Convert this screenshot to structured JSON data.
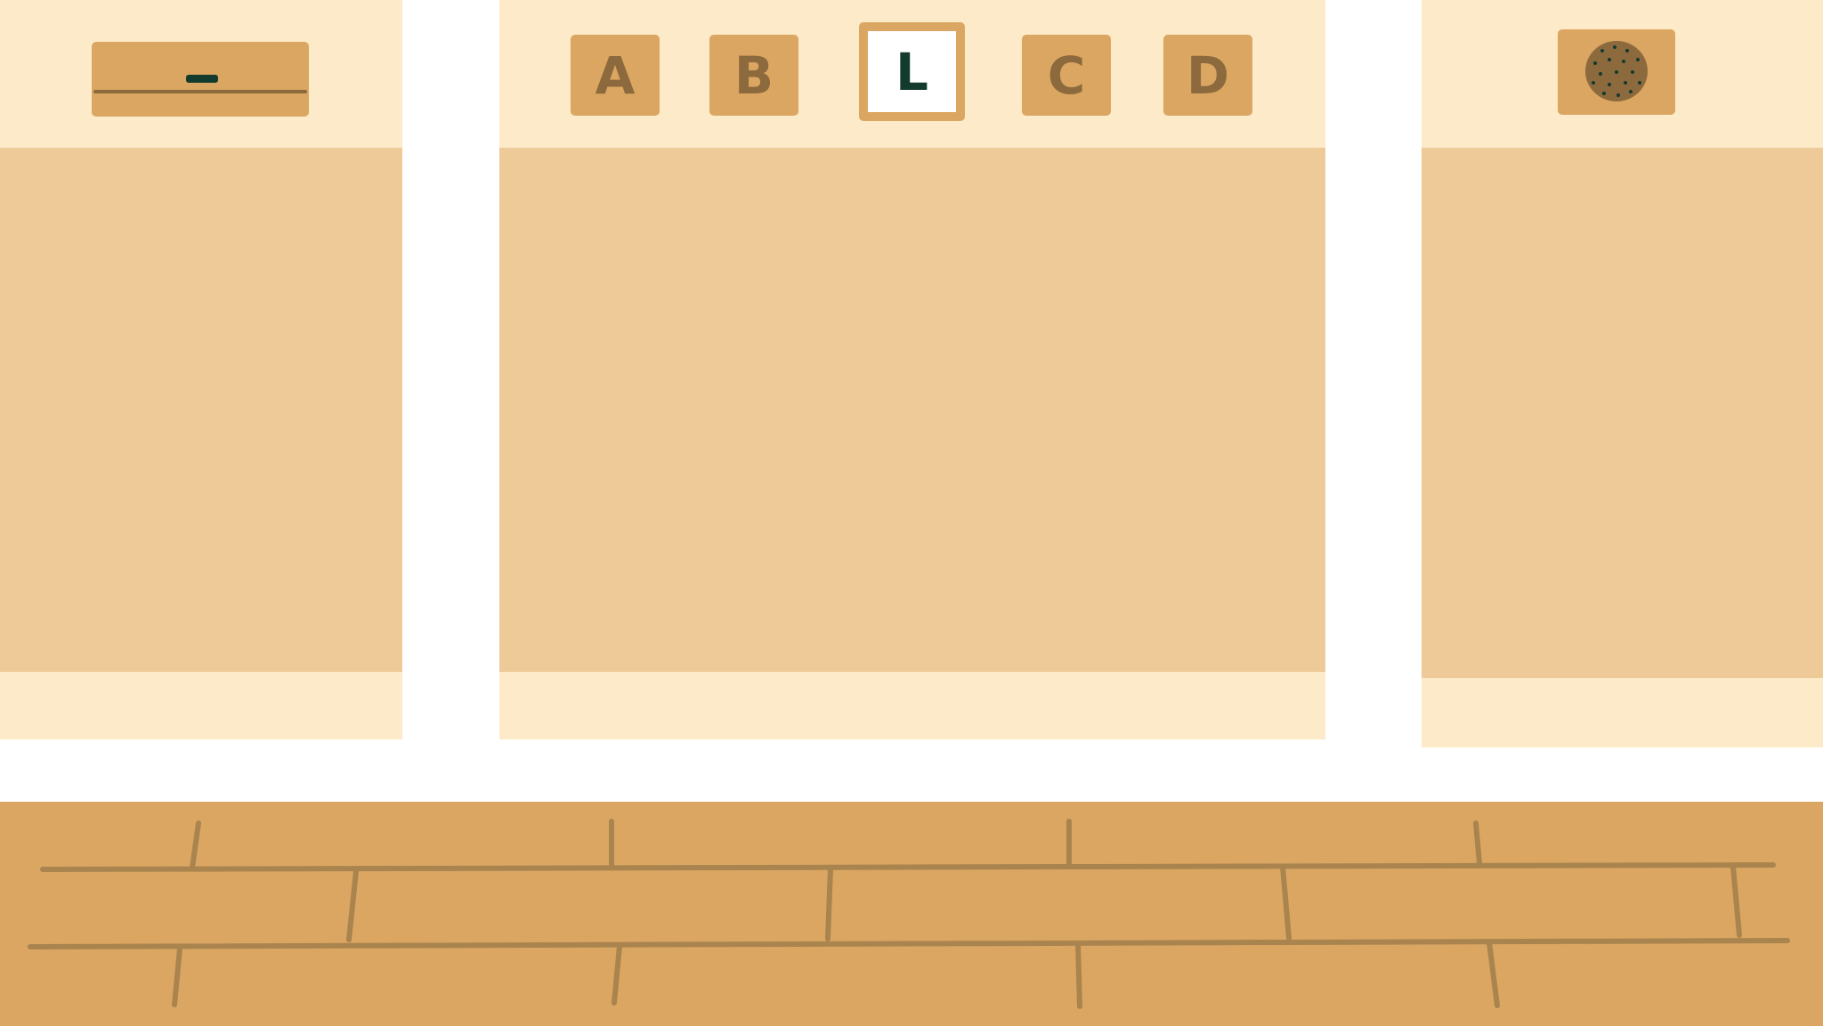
{
  "colors": {
    "panel_light": "#fdeac8",
    "panel_body": "#edca98",
    "tile": "#dba662",
    "tile_text": "#8c6a3d",
    "selected_text": "#123b2e",
    "floor": "#dba662",
    "floor_lines": "#a9844e",
    "background": "#ffffff"
  },
  "left_panel": {
    "button_icon": "minus-bar-icon"
  },
  "center_panel": {
    "tiles": [
      {
        "label": "A",
        "selected": false
      },
      {
        "label": "B",
        "selected": false
      },
      {
        "label": "L",
        "selected": true
      },
      {
        "label": "C",
        "selected": false
      },
      {
        "label": "D",
        "selected": false
      }
    ]
  },
  "right_panel": {
    "button_icon": "cookie-icon"
  }
}
